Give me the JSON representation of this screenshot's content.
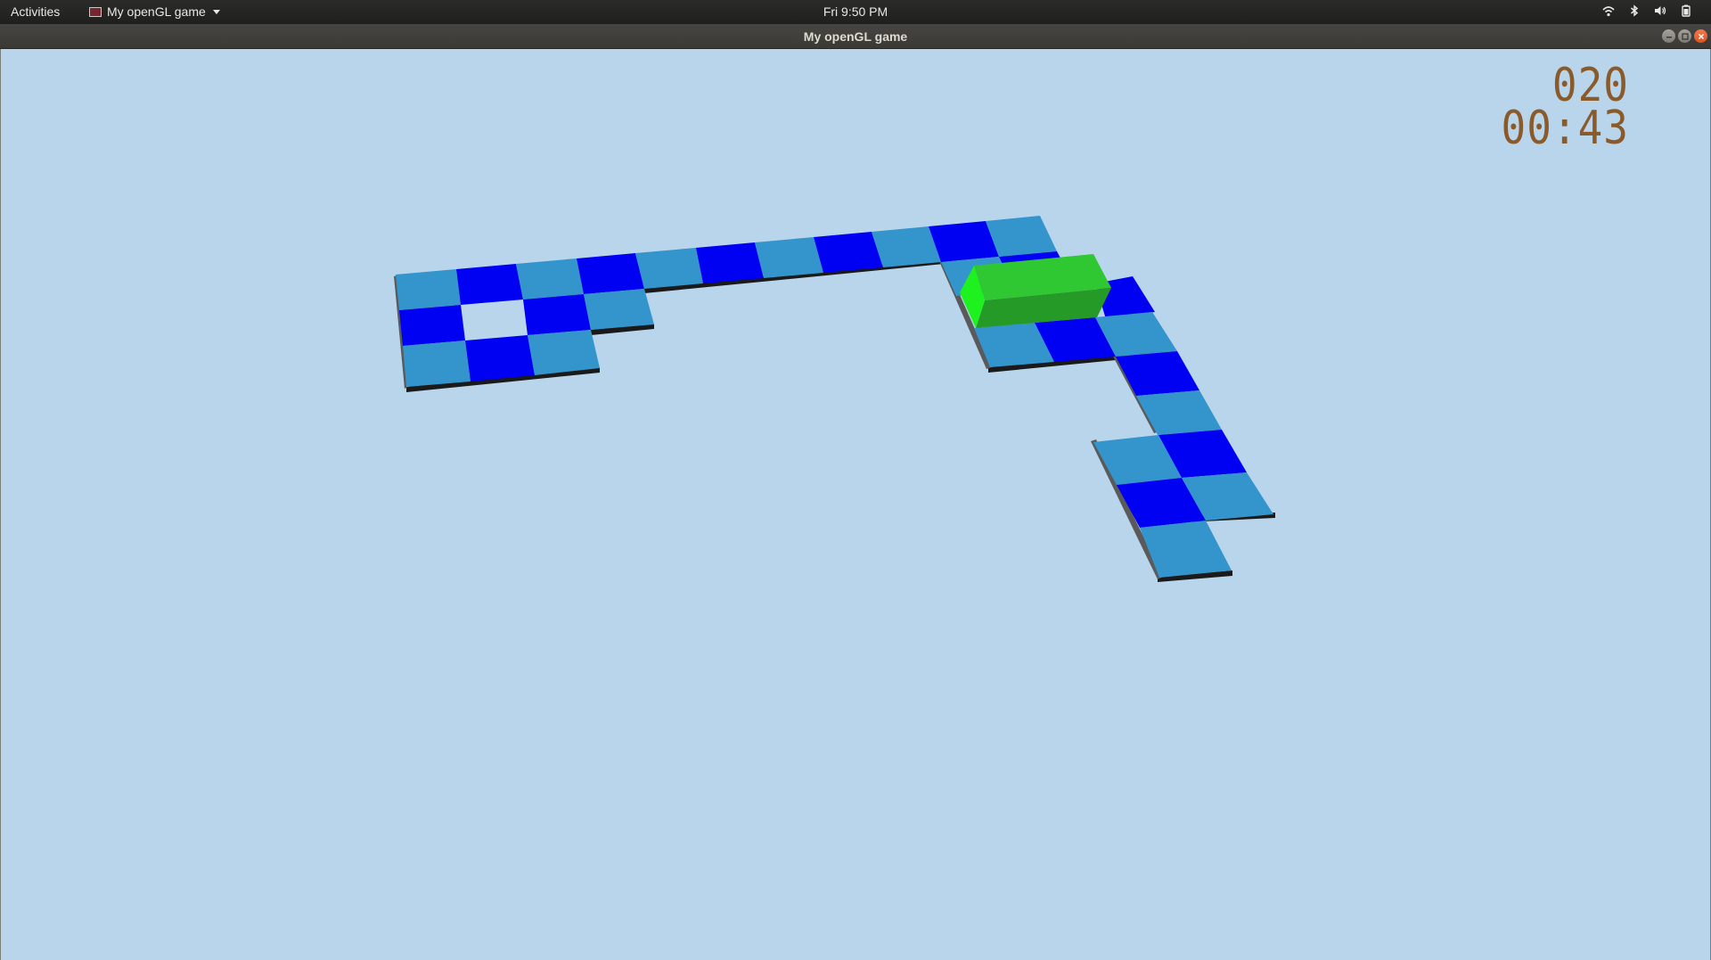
{
  "topbar": {
    "activities": "Activities",
    "app_name": "My openGL game",
    "clock": "Fri  9:50 PM",
    "tray_icons": [
      "wifi-icon",
      "bluetooth-icon",
      "volume-icon",
      "battery-icon"
    ]
  },
  "window": {
    "title": "My openGL game",
    "controls": [
      "minimize",
      "maximize",
      "close"
    ]
  },
  "game": {
    "score": "020",
    "time": "00:43",
    "colors": {
      "background": "#b8d5ec",
      "tile_dark": "#0000f2",
      "tile_light": "#3395cc",
      "tile_edge": "#1a1a1a",
      "block_top": "#2fc832",
      "block_front": "#259a27",
      "block_end": "#1ef21e",
      "hud_text": "#8b5a2b"
    }
  }
}
